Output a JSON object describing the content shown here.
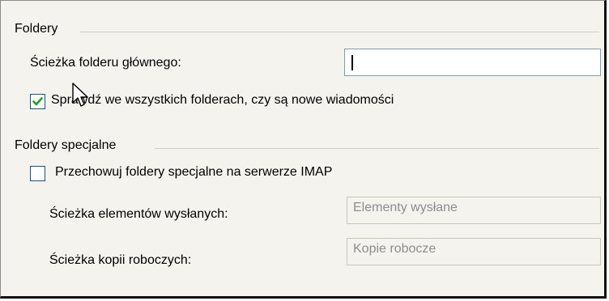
{
  "folders_group": {
    "title": "Foldery",
    "root_path_label": "Ścieżka folderu głównego:",
    "root_path_value": "",
    "check_all_label": "Sprawdź we wszystkich folderach, czy są nowe wiadomości",
    "check_all_checked": true
  },
  "special_group": {
    "title": "Foldery specjalne",
    "store_on_server_label": "Przechowuj foldery specjalne na serwerze IMAP",
    "store_on_server_checked": false,
    "sent_path_label": "Ścieżka elementów wysłanych:",
    "sent_path_value": "Elementy wysłane",
    "drafts_path_label": "Ścieżka kopii roboczych:",
    "drafts_path_value": "Kopie robocze"
  },
  "colors": {
    "dialog_bg": "#f4f3ee",
    "checkbox_border": "#1c5180",
    "check_mark": "#21a121",
    "input_border": "#7f9db9",
    "disabled_text": "#8d8d8d"
  },
  "icons": [
    "check-icon",
    "mouse-cursor-icon"
  ]
}
